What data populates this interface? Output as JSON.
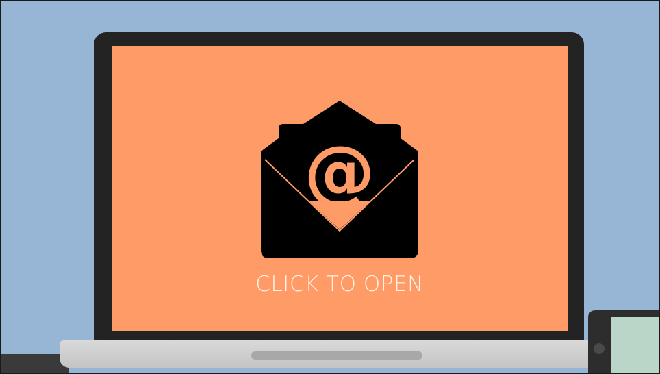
{
  "cta": {
    "label": "CLICK TO OPEN"
  },
  "icons": {
    "email": "envelope-at-icon"
  },
  "colors": {
    "wall": "#97b5d4",
    "screen": "#ff9b66",
    "bezel": "#232323",
    "icon": "#000000",
    "label": "#fff3ea"
  }
}
